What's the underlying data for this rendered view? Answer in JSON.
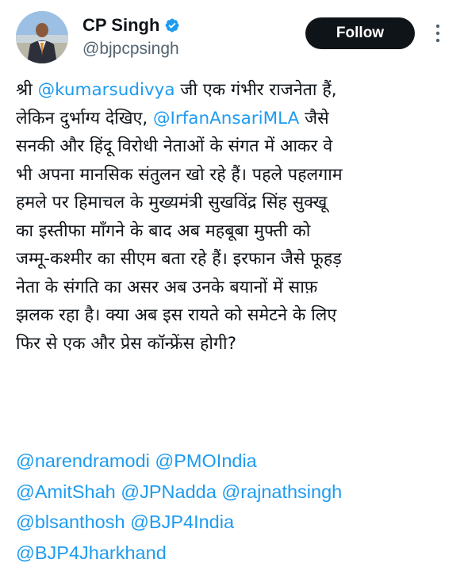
{
  "author": {
    "display_name": "CP Singh",
    "handle": "@bjpcpsingh",
    "verified": true
  },
  "actions": {
    "follow_label": "Follow"
  },
  "colors": {
    "accent": "#1d9bf0",
    "text": "#0f1419",
    "secondary": "#536471",
    "button_bg": "#0f1419"
  },
  "tweet": {
    "lines": [
      [
        "श्री ",
        "@kumarsudivya",
        " जी एक गंभीर राजनेता हैं,"
      ],
      [
        "लेकिन दुर्भाग्य देखिए, ",
        "@IrfanAnsariMLA",
        " जैसे"
      ],
      [
        "सनकी और हिंदू विरोधी नेताओं के संगत में आकर वे"
      ],
      [
        "भी अपना मानसिक संतुलन खो रहे हैं। पहले पहलगाम"
      ],
      [
        "हमले पर हिमाचल के मुख्यमंत्री सुखविंद्र सिंह सुक्खू"
      ],
      [
        "का इस्तीफा माँगने के बाद अब महबूबा मुफ्ती को"
      ],
      [
        "जम्मू-कश्मीर का सीएम बता रहे हैं। इरफान जैसे फूहड़"
      ],
      [
        "नेता के संगति का असर अब उनके बयानों में साफ़"
      ],
      [
        "झलक रहा है। क्या अब इस रायते को समेटने के लिए"
      ],
      [
        "फिर से एक और प्रेस कॉन्फ्रेंस होगी?"
      ]
    ],
    "tag_lines": [
      [
        "@narendramodi",
        "@PMOIndia"
      ],
      [
        "@AmitShah",
        "@JPNadda",
        "@rajnathsingh"
      ],
      [
        "@blsanthosh",
        "@BJP4India"
      ],
      [
        "@BJP4Jharkhand"
      ]
    ]
  },
  "icons": {
    "verified": "verified-badge-icon",
    "more": "more-vertical-icon",
    "avatar": "profile-photo"
  }
}
